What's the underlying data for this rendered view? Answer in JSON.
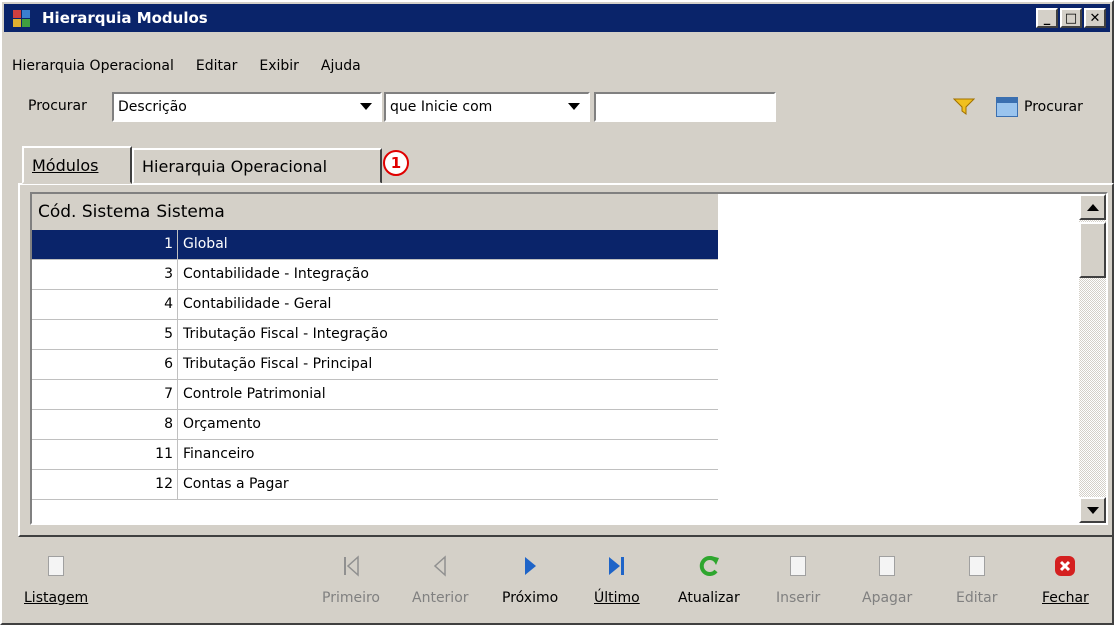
{
  "window": {
    "title": "Hierarquia Modulos",
    "buttons": [
      "_",
      "□",
      "✕"
    ]
  },
  "menu": [
    "Hierarquia Operacional",
    "Editar",
    "Exibir",
    "Ajuda"
  ],
  "search": {
    "label": "Procurar",
    "field": "Descrição",
    "condition": "que Inicie com",
    "value": "",
    "button_label": "Procurar"
  },
  "tabs": [
    "Módulos",
    "Hierarquia Operacional"
  ],
  "annotation": "1",
  "grid": {
    "headers": [
      "Cód. Sistema",
      "Sistema"
    ],
    "rows": [
      {
        "code": "1",
        "name": "Global",
        "selected": true
      },
      {
        "code": "3",
        "name": "Contabilidade - Integração"
      },
      {
        "code": "4",
        "name": "Contabilidade - Geral"
      },
      {
        "code": "5",
        "name": "Tributação Fiscal - Integração"
      },
      {
        "code": "6",
        "name": "Tributação Fiscal - Principal"
      },
      {
        "code": "7",
        "name": "Controle Patrimonial"
      },
      {
        "code": "8",
        "name": "Orçamento"
      },
      {
        "code": "11",
        "name": "Financeiro"
      },
      {
        "code": "12",
        "name": "Contas a Pagar"
      }
    ]
  },
  "toolbar": {
    "listagem": "Listagem",
    "primeiro": "Primeiro",
    "anterior": "Anterior",
    "proximo": "Próximo",
    "ultimo": "Último",
    "atualizar": "Atualizar",
    "inserir": "Inserir",
    "apagar": "Apagar",
    "editar": "Editar",
    "fechar": "Fechar"
  },
  "colors": {
    "selection": "#0a246a",
    "nav_blue": "#1e64c8",
    "refresh_green": "#2ea62e",
    "close_red": "#d42020"
  }
}
